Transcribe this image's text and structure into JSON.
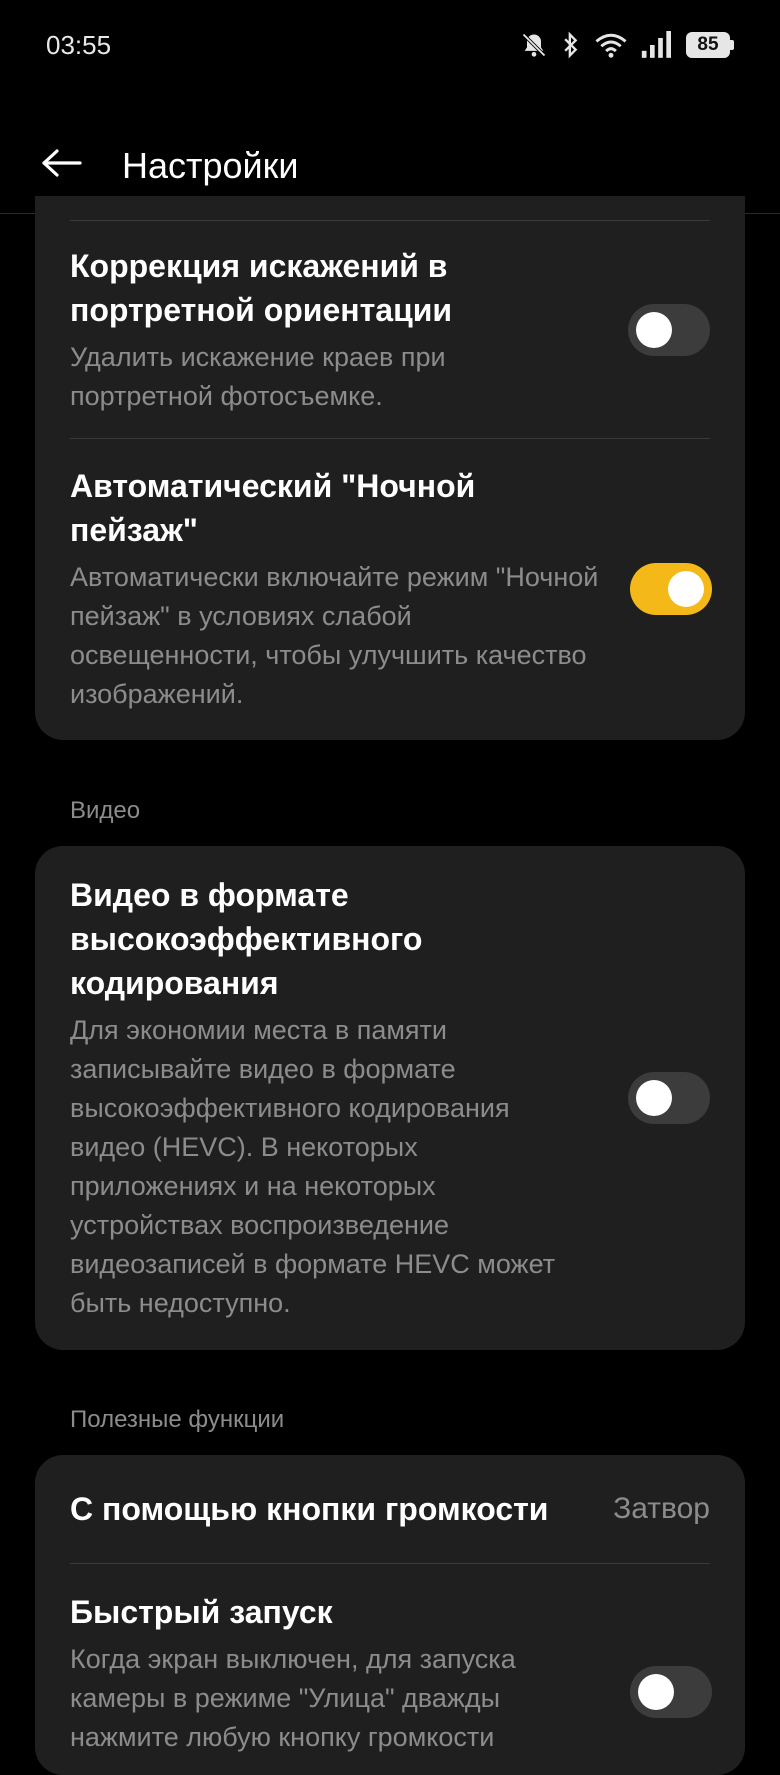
{
  "status_bar": {
    "time": "03:55",
    "battery": "85",
    "icons": [
      "bell-off-icon",
      "bluetooth-icon",
      "wifi-icon",
      "signal-icon",
      "battery-icon"
    ]
  },
  "header": {
    "title": "Настройки",
    "back_icon": "arrow-left-icon"
  },
  "card_photo": {
    "items": [
      {
        "title": "Коррекция искажений в портретной ориентации",
        "description": "Удалить искажение краев при портретной фотосъемке.",
        "toggle": "off"
      },
      {
        "title": "Автоматический \"Ночной пейзаж\"",
        "description": "Автоматически включайте режим \"Ночной пейзаж\" в условиях слабой освещенности, чтобы улучшить качество изображений.",
        "toggle": "on"
      }
    ]
  },
  "section_video": {
    "header": "Видео",
    "items": [
      {
        "title": "Видео в формате высокоэффективного кодирования",
        "description": "Для экономии места в памяти записывайте видео в формате высокоэффективного кодирования видео (HEVC). В некоторых приложениях и на некоторых устройствах воспроизведение видеозаписей в формате HEVC может быть недоступно.",
        "toggle": "off"
      }
    ]
  },
  "section_useful": {
    "header": "Полезные функции",
    "items": [
      {
        "title": "С помощью кнопки громкости",
        "value": "Затвор"
      },
      {
        "title": "Быстрый запуск",
        "description": "Когда экран выключен, для запуска камеры в режиме \"Улица\" дважды нажмите любую кнопку громкости",
        "toggle": "off"
      }
    ]
  },
  "colors": {
    "accent": "#f4b818",
    "card": "#1f1f1f",
    "background": "#000000",
    "secondary_text": "#8c8c8c"
  }
}
